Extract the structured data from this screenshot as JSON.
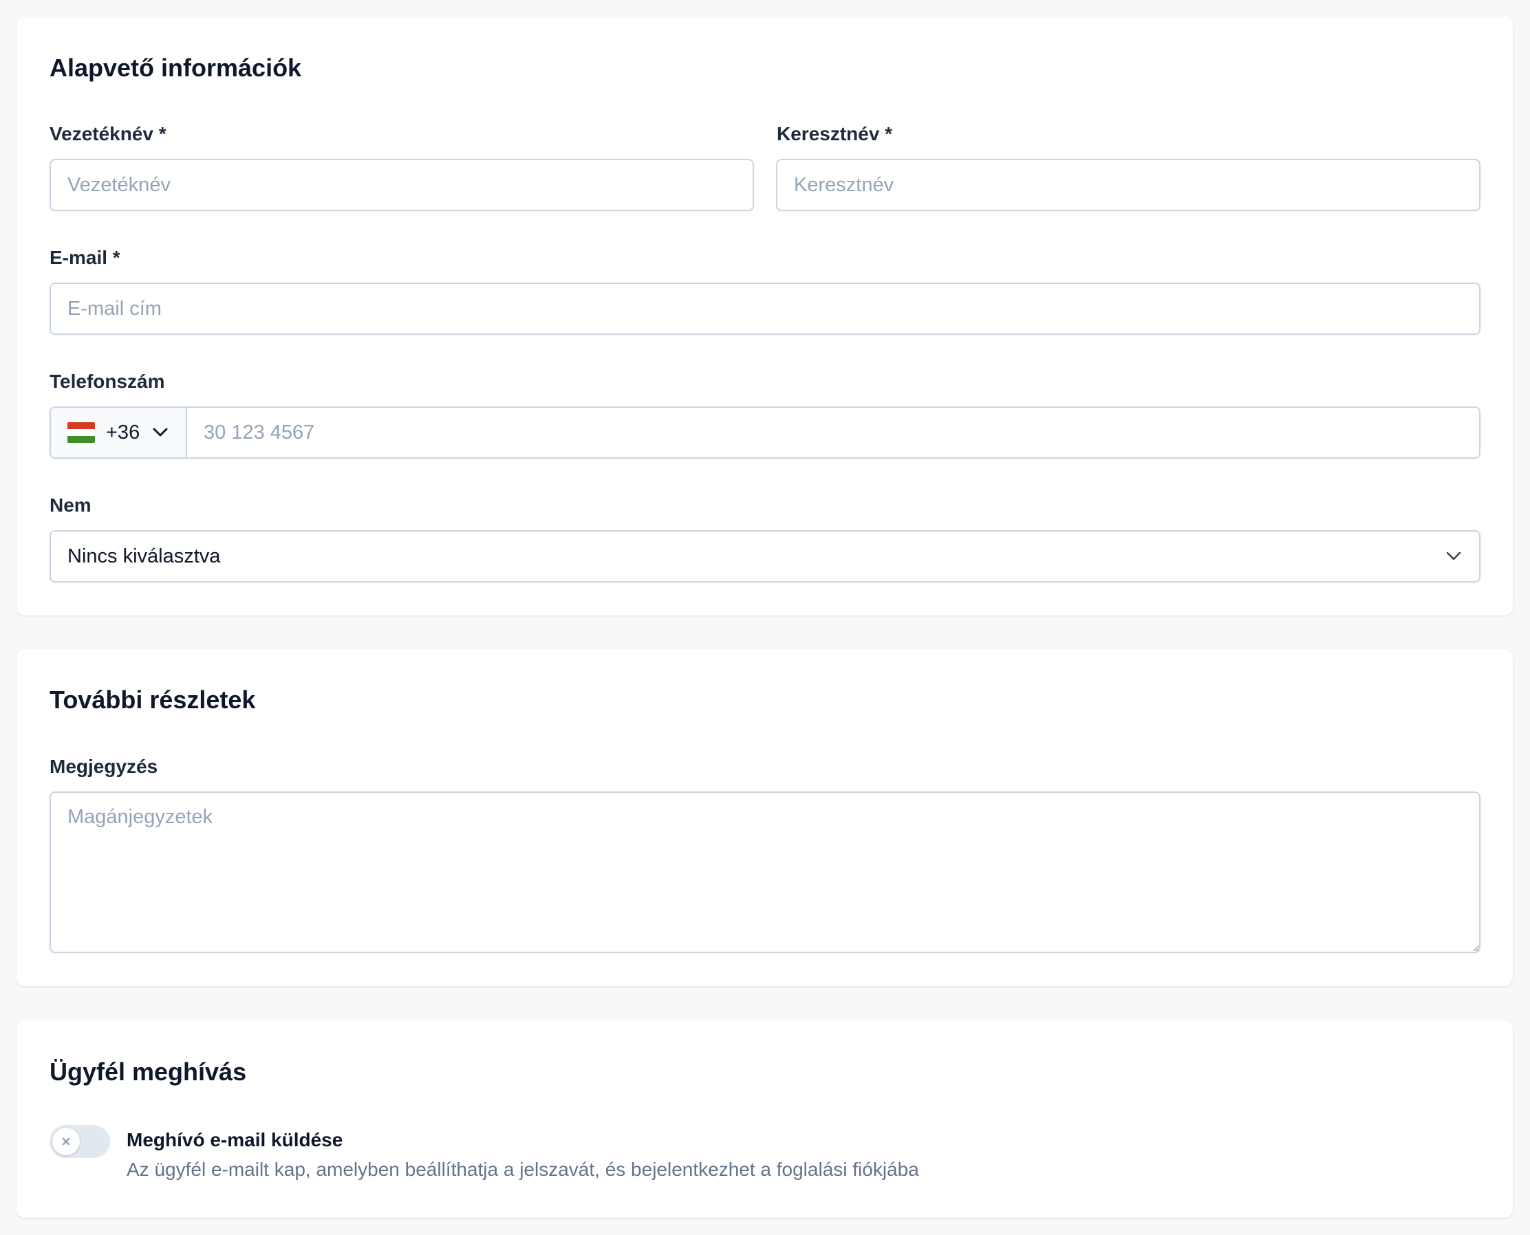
{
  "sections": {
    "basic": {
      "title": "Alapvető információk",
      "last_name": {
        "label": "Vezetéknév *",
        "placeholder": "Vezetéknév",
        "value": ""
      },
      "first_name": {
        "label": "Keresztnév *",
        "placeholder": "Keresztnév",
        "value": ""
      },
      "email": {
        "label": "E-mail *",
        "placeholder": "E-mail cím",
        "value": ""
      },
      "phone": {
        "label": "Telefonszám",
        "country_code": "+36",
        "country_flag": "hungary-flag",
        "placeholder": "30 123 4567",
        "value": ""
      },
      "gender": {
        "label": "Nem",
        "selected": "Nincs kiválasztva"
      }
    },
    "details": {
      "title": "További részletek",
      "note": {
        "label": "Megjegyzés",
        "placeholder": "Magánjegyzetek",
        "value": ""
      }
    },
    "invite": {
      "title": "Ügyfél meghívás",
      "toggle": {
        "label": "Meghívó e-mail küldése",
        "description": "Az ügyfél e-mailt kap, amelyben beállíthatja a jelszavát, és bejelentkezhet a foglalási fiókjába",
        "checked": false
      }
    }
  },
  "colors": {
    "background": "#f7f8fa",
    "card": "#ffffff",
    "border": "#cbd5e1",
    "placeholder": "#94a3b8",
    "muted_text": "#64748b",
    "toggle_off": "#e2e8f0",
    "flag_red": "#d63b26",
    "flag_white": "#ffffff",
    "flag_green": "#3f8f29"
  }
}
